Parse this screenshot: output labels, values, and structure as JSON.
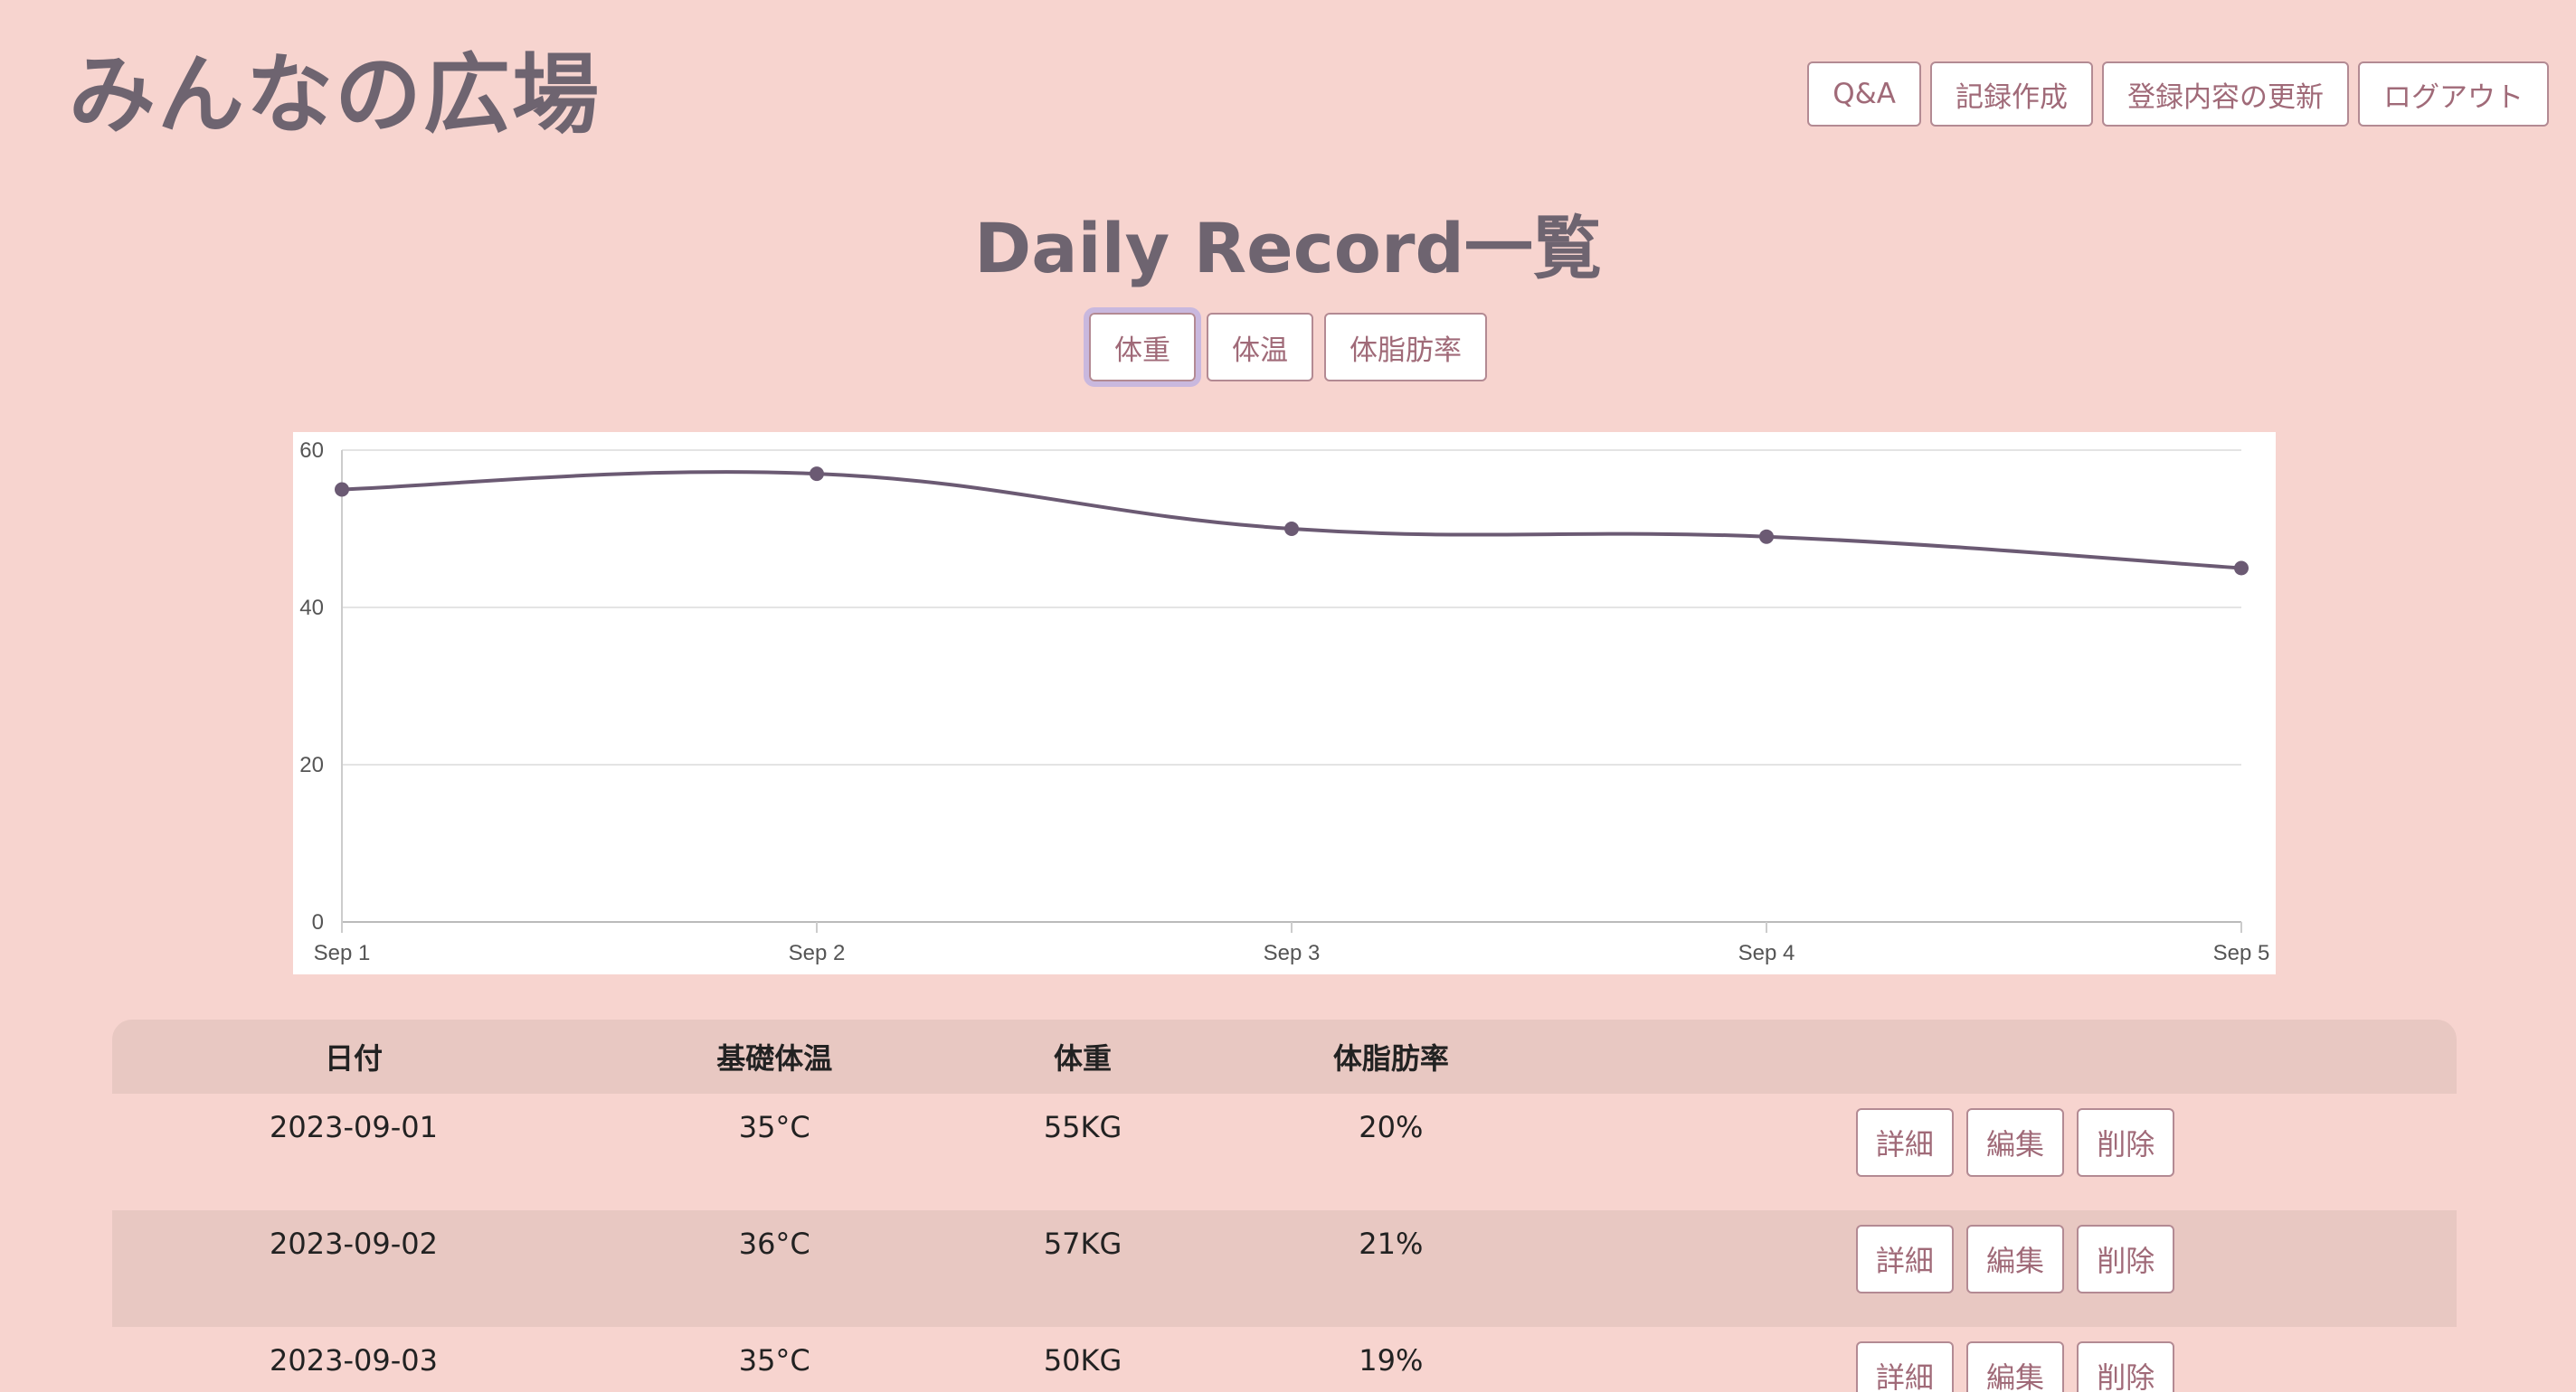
{
  "site": {
    "title": "みんなの広場"
  },
  "nav": [
    {
      "label": "Q&A"
    },
    {
      "label": "記録作成"
    },
    {
      "label": "登録内容の更新"
    },
    {
      "label": "ログアウト"
    }
  ],
  "page": {
    "heading": "Daily Record一覧"
  },
  "metric_tabs": [
    {
      "label": "体重",
      "active": true
    },
    {
      "label": "体温",
      "active": false
    },
    {
      "label": "体脂肪率",
      "active": false
    }
  ],
  "chart_data": {
    "type": "line",
    "categories": [
      "Sep 1",
      "Sep 2",
      "Sep 3",
      "Sep 4",
      "Sep 5"
    ],
    "series": [
      {
        "values": [
          55,
          57,
          50,
          49,
          45
        ]
      }
    ],
    "ylim": [
      0,
      60
    ],
    "yticks": [
      0,
      20,
      40,
      60
    ],
    "grid": true,
    "line_color": "#6b5a73"
  },
  "table": {
    "headers": [
      "日付",
      "基礎体温",
      "体重",
      "体脂肪率",
      ""
    ],
    "action_labels": {
      "detail": "詳細",
      "edit": "編集",
      "delete": "削除"
    },
    "rows": [
      {
        "date": "2023-09-01",
        "temp": "35°C",
        "weight": "55KG",
        "fat": "20%"
      },
      {
        "date": "2023-09-02",
        "temp": "36°C",
        "weight": "57KG",
        "fat": "21%"
      },
      {
        "date": "2023-09-03",
        "temp": "35°C",
        "weight": "50KG",
        "fat": "19%"
      }
    ]
  },
  "colors": {
    "background": "#f7d4cf",
    "title": "#6e6470",
    "button_text": "#a06a78",
    "row_stripe": "#e8c8c2"
  }
}
